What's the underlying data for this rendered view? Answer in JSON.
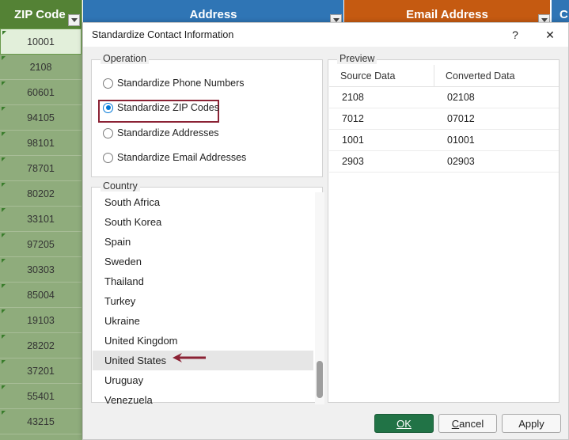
{
  "spreadsheet": {
    "headers": {
      "zip": "ZIP Code",
      "address": "Address",
      "email": "Email Address",
      "extra": "C"
    },
    "zip_values": [
      "10001",
      "2108",
      "60601",
      "94105",
      "98101",
      "78701",
      "80202",
      "33101",
      "97205",
      "30303",
      "85004",
      "19103",
      "28202",
      "37201",
      "55401",
      "43215"
    ]
  },
  "dialog": {
    "title": "Standardize Contact Information",
    "help_label": "?",
    "close_label": "✕",
    "operation": {
      "legend": "Operation",
      "options": [
        {
          "label": "Standardize Phone Numbers",
          "checked": false
        },
        {
          "label": "Standardize ZIP Codes",
          "checked": true
        },
        {
          "label": "Standardize Addresses",
          "checked": false
        },
        {
          "label": "Standardize Email Addresses",
          "checked": false
        }
      ]
    },
    "country": {
      "legend": "Country",
      "items": [
        "South Africa",
        "South Korea",
        "Spain",
        "Sweden",
        "Thailand",
        "Turkey",
        "Ukraine",
        "United Kingdom",
        "United States",
        "Uruguay",
        "Venezuela"
      ],
      "selected": "United States"
    },
    "preview": {
      "legend": "Preview",
      "columns": [
        "Source Data",
        "Converted Data"
      ],
      "rows": [
        [
          "2108",
          "02108"
        ],
        [
          "7012",
          "07012"
        ],
        [
          "1001",
          "01001"
        ],
        [
          "2903",
          "02903"
        ]
      ]
    },
    "buttons": {
      "ok": "OK",
      "cancel_first": "C",
      "cancel_rest": "ancel",
      "apply": "Apply"
    }
  },
  "colors": {
    "zip_header": "#548235",
    "address_header": "#2f75b5",
    "email_header": "#c55a11",
    "ok_button": "#217346",
    "highlight": "#8b2234"
  }
}
